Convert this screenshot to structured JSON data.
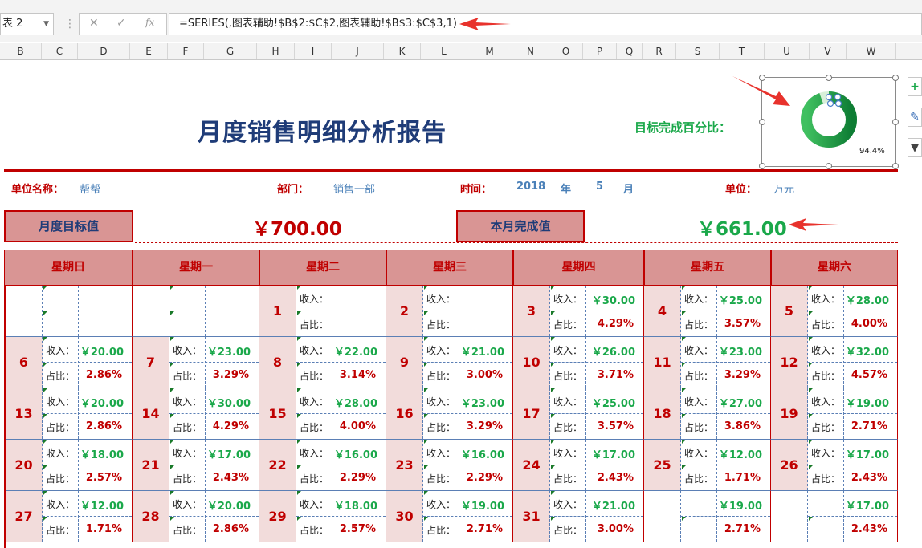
{
  "formula_bar": {
    "name_box": "表 2",
    "cancel_glyph": "✕",
    "enter_glyph": "✓",
    "fx_glyph": "fx",
    "formula": "=SERIES(,图表辅助!$B$2:$C$2,图表辅助!$B$3:$C$3,1)"
  },
  "columns": [
    "B",
    "C",
    "D",
    "E",
    "F",
    "G",
    "H",
    "I",
    "J",
    "K",
    "L",
    "M",
    "N",
    "O",
    "P",
    "Q",
    "R",
    "S",
    "T",
    "U",
    "V",
    "W"
  ],
  "report": {
    "title": "月度销售明细分析报告",
    "goal_label": "目标完成百分比：",
    "chart": {
      "type": "doughnut",
      "percent_label": "94.4%",
      "percent": 94.4,
      "color": "#1aa84a"
    },
    "unit_name_label": "单位名称：",
    "unit_name": "帮帮",
    "dept_label": "部门：",
    "dept": "销售一部",
    "time_label": "时间：",
    "year": "2018",
    "year_unit": "年",
    "month": "5",
    "month_unit": "月",
    "unit_label": "单位：",
    "unit": "万元",
    "target_label": "月度目标值",
    "target_value": "￥700.00",
    "done_label": "本月完成值",
    "done_value": "￥661.00"
  },
  "calendar": {
    "weekdays": [
      "星期日",
      "星期一",
      "星期二",
      "星期三",
      "星期四",
      "星期五",
      "星期六"
    ],
    "income_label": "收入：",
    "ratio_label": "占比：",
    "weeks": [
      [
        {
          "day": "",
          "income": "",
          "ratio": ""
        },
        {
          "day": "",
          "income": "",
          "ratio": ""
        },
        {
          "day": "1",
          "income": "",
          "ratio": ""
        },
        {
          "day": "2",
          "income": "",
          "ratio": ""
        },
        {
          "day": "3",
          "income": "￥30.00",
          "ratio": "4.29%"
        },
        {
          "day": "4",
          "income": "￥25.00",
          "ratio": "3.57%"
        },
        {
          "day": "5",
          "income": "￥28.00",
          "ratio": "4.00%"
        }
      ],
      [
        {
          "day": "6",
          "income": "￥20.00",
          "ratio": "2.86%"
        },
        {
          "day": "7",
          "income": "￥23.00",
          "ratio": "3.29%"
        },
        {
          "day": "8",
          "income": "￥22.00",
          "ratio": "3.14%"
        },
        {
          "day": "9",
          "income": "￥21.00",
          "ratio": "3.00%"
        },
        {
          "day": "10",
          "income": "￥26.00",
          "ratio": "3.71%"
        },
        {
          "day": "11",
          "income": "￥23.00",
          "ratio": "3.29%"
        },
        {
          "day": "12",
          "income": "￥32.00",
          "ratio": "4.57%"
        }
      ],
      [
        {
          "day": "13",
          "income": "￥20.00",
          "ratio": "2.86%"
        },
        {
          "day": "14",
          "income": "￥30.00",
          "ratio": "4.29%"
        },
        {
          "day": "15",
          "income": "￥28.00",
          "ratio": "4.00%"
        },
        {
          "day": "16",
          "income": "￥23.00",
          "ratio": "3.29%"
        },
        {
          "day": "17",
          "income": "￥25.00",
          "ratio": "3.57%"
        },
        {
          "day": "18",
          "income": "￥27.00",
          "ratio": "3.86%"
        },
        {
          "day": "19",
          "income": "￥19.00",
          "ratio": "2.71%"
        }
      ],
      [
        {
          "day": "20",
          "income": "￥18.00",
          "ratio": "2.57%"
        },
        {
          "day": "21",
          "income": "￥17.00",
          "ratio": "2.43%"
        },
        {
          "day": "22",
          "income": "￥16.00",
          "ratio": "2.29%"
        },
        {
          "day": "23",
          "income": "￥16.00",
          "ratio": "2.29%"
        },
        {
          "day": "24",
          "income": "￥17.00",
          "ratio": "2.43%"
        },
        {
          "day": "25",
          "income": "￥12.00",
          "ratio": "1.71%"
        },
        {
          "day": "26",
          "income": "￥17.00",
          "ratio": "2.43%"
        }
      ],
      [
        {
          "day": "27",
          "income": "￥12.00",
          "ratio": "1.71%"
        },
        {
          "day": "28",
          "income": "￥20.00",
          "ratio": "2.86%"
        },
        {
          "day": "29",
          "income": "￥18.00",
          "ratio": "2.57%"
        },
        {
          "day": "30",
          "income": "￥19.00",
          "ratio": "2.71%"
        },
        {
          "day": "31",
          "income": "￥21.00",
          "ratio": "3.00%"
        },
        {
          "day": "",
          "income": "￥19.00",
          "ratio": "2.71%",
          "no_labels": true
        },
        {
          "day": "",
          "income": "￥17.00",
          "ratio": "2.43%",
          "no_labels": true
        }
      ]
    ]
  }
}
